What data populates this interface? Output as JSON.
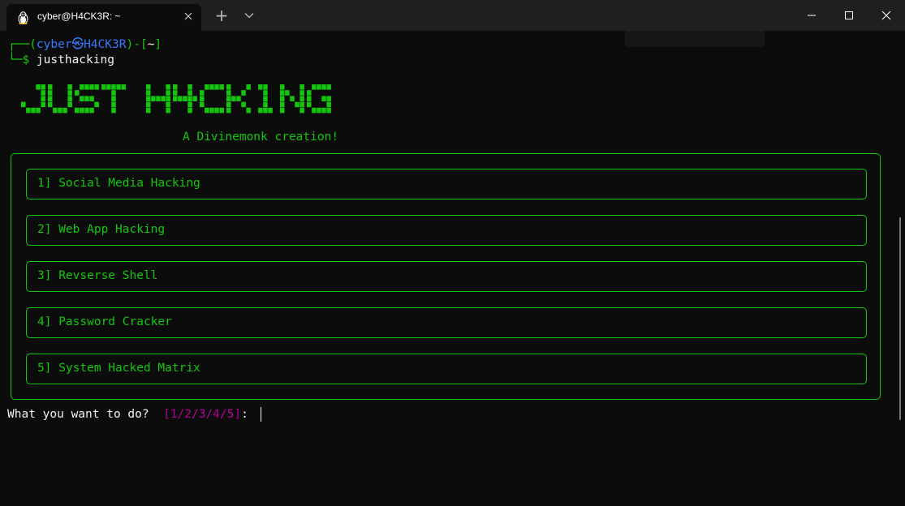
{
  "window": {
    "tab_title": "cyber@H4CK3R: ~",
    "tab_icon": "linux-penguin-icon",
    "close_tab_icon": "close-icon",
    "new_tab_symbol": "+",
    "controls": [
      "minimize-icon",
      "maximize-icon",
      "close-icon"
    ]
  },
  "terminal": {
    "prompt": {
      "line1_open": "┌──(",
      "user": "cyber",
      "at_symbol": "㉿",
      "host": "H4CK3R",
      "line1_mid": ")-[",
      "path": "~",
      "line1_close": "]",
      "line2_prefix": "└─$ ",
      "command": "justhacking"
    },
    "banner_text": "JUST H4CK1NG",
    "tagline": "A Divinemonk creation!",
    "menu": [
      {
        "label": "1] Social Media Hacking"
      },
      {
        "label": "2] Web App Hacking"
      },
      {
        "label": "3] Revserse Shell"
      },
      {
        "label": "4] Password Cracker"
      },
      {
        "label": "5] System Hacked Matrix"
      }
    ],
    "input_prompt": "What you want to do?  ",
    "input_choices": "[1/2/3/4/5]",
    "input_suffix": ": "
  },
  "colors": {
    "background": "#0c0c0c",
    "titlebar": "#202020",
    "green": "#13c60c",
    "blue": "#3b78ff",
    "magenta": "#b4009e",
    "white": "#f2f2f2"
  }
}
